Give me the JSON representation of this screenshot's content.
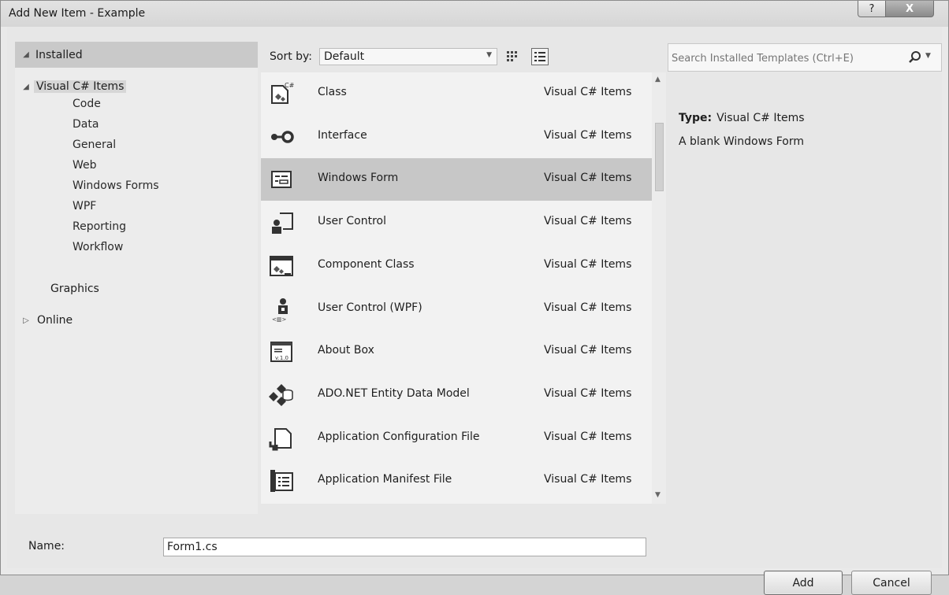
{
  "window": {
    "title": "Add New Item - Example",
    "help_glyph": "?",
    "close_glyph": "X"
  },
  "tree": {
    "installed_label": "Installed",
    "root": "Visual C# Items",
    "children": [
      "Code",
      "Data",
      "General",
      "Web",
      "Windows Forms",
      "WPF",
      "Reporting",
      "Workflow"
    ],
    "graphics": "Graphics",
    "online": "Online"
  },
  "toolbar": {
    "sort_label": "Sort by:",
    "sort_value": "Default"
  },
  "templates": [
    {
      "name": "Class",
      "category": "Visual C# Items",
      "icon": "class-icon"
    },
    {
      "name": "Interface",
      "category": "Visual C# Items",
      "icon": "interface-icon"
    },
    {
      "name": "Windows Form",
      "category": "Visual C# Items",
      "icon": "windows-form-icon",
      "selected": true
    },
    {
      "name": "User Control",
      "category": "Visual C# Items",
      "icon": "user-control-icon"
    },
    {
      "name": "Component Class",
      "category": "Visual C# Items",
      "icon": "component-class-icon"
    },
    {
      "name": "User Control (WPF)",
      "category": "Visual C# Items",
      "icon": "user-control-wpf-icon"
    },
    {
      "name": "About Box",
      "category": "Visual C# Items",
      "icon": "about-box-icon"
    },
    {
      "name": "ADO.NET Entity Data Model",
      "category": "Visual C# Items",
      "icon": "entity-data-model-icon"
    },
    {
      "name": "Application Configuration File",
      "category": "Visual C# Items",
      "icon": "config-file-icon"
    },
    {
      "name": "Application Manifest File",
      "category": "Visual C# Items",
      "icon": "manifest-file-icon"
    }
  ],
  "search": {
    "placeholder": "Search Installed Templates (Ctrl+E)"
  },
  "info": {
    "type_label": "Type:",
    "type_value": "Visual C# Items",
    "description": "A blank Windows Form"
  },
  "form": {
    "name_label": "Name:",
    "name_value": "Form1.cs"
  },
  "buttons": {
    "add": "Add",
    "cancel": "Cancel"
  }
}
